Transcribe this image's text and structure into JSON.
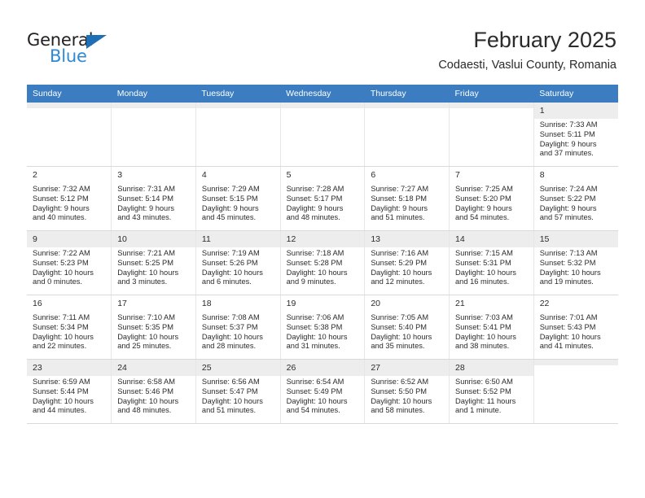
{
  "brand": {
    "name_part1": "General",
    "name_part2": "Blue",
    "accent_color": "#2e8ad4",
    "triangle_color": "#1f6fb5"
  },
  "header": {
    "title": "February 2025",
    "subtitle": "Codaesti, Vaslui County, Romania"
  },
  "calendar": {
    "header_color": "#3b7dc0",
    "weekdays": [
      "Sunday",
      "Monday",
      "Tuesday",
      "Wednesday",
      "Thursday",
      "Friday",
      "Saturday"
    ],
    "weeks": [
      [
        {
          "day": "",
          "sunrise": "",
          "sunset": "",
          "daylight1": "",
          "daylight2": ""
        },
        {
          "day": "",
          "sunrise": "",
          "sunset": "",
          "daylight1": "",
          "daylight2": ""
        },
        {
          "day": "",
          "sunrise": "",
          "sunset": "",
          "daylight1": "",
          "daylight2": ""
        },
        {
          "day": "",
          "sunrise": "",
          "sunset": "",
          "daylight1": "",
          "daylight2": ""
        },
        {
          "day": "",
          "sunrise": "",
          "sunset": "",
          "daylight1": "",
          "daylight2": ""
        },
        {
          "day": "",
          "sunrise": "",
          "sunset": "",
          "daylight1": "",
          "daylight2": ""
        },
        {
          "day": "1",
          "sunrise": "Sunrise: 7:33 AM",
          "sunset": "Sunset: 5:11 PM",
          "daylight1": "Daylight: 9 hours",
          "daylight2": "and 37 minutes."
        }
      ],
      [
        {
          "day": "2",
          "sunrise": "Sunrise: 7:32 AM",
          "sunset": "Sunset: 5:12 PM",
          "daylight1": "Daylight: 9 hours",
          "daylight2": "and 40 minutes."
        },
        {
          "day": "3",
          "sunrise": "Sunrise: 7:31 AM",
          "sunset": "Sunset: 5:14 PM",
          "daylight1": "Daylight: 9 hours",
          "daylight2": "and 43 minutes."
        },
        {
          "day": "4",
          "sunrise": "Sunrise: 7:29 AM",
          "sunset": "Sunset: 5:15 PM",
          "daylight1": "Daylight: 9 hours",
          "daylight2": "and 45 minutes."
        },
        {
          "day": "5",
          "sunrise": "Sunrise: 7:28 AM",
          "sunset": "Sunset: 5:17 PM",
          "daylight1": "Daylight: 9 hours",
          "daylight2": "and 48 minutes."
        },
        {
          "day": "6",
          "sunrise": "Sunrise: 7:27 AM",
          "sunset": "Sunset: 5:18 PM",
          "daylight1": "Daylight: 9 hours",
          "daylight2": "and 51 minutes."
        },
        {
          "day": "7",
          "sunrise": "Sunrise: 7:25 AM",
          "sunset": "Sunset: 5:20 PM",
          "daylight1": "Daylight: 9 hours",
          "daylight2": "and 54 minutes."
        },
        {
          "day": "8",
          "sunrise": "Sunrise: 7:24 AM",
          "sunset": "Sunset: 5:22 PM",
          "daylight1": "Daylight: 9 hours",
          "daylight2": "and 57 minutes."
        }
      ],
      [
        {
          "day": "9",
          "sunrise": "Sunrise: 7:22 AM",
          "sunset": "Sunset: 5:23 PM",
          "daylight1": "Daylight: 10 hours",
          "daylight2": "and 0 minutes."
        },
        {
          "day": "10",
          "sunrise": "Sunrise: 7:21 AM",
          "sunset": "Sunset: 5:25 PM",
          "daylight1": "Daylight: 10 hours",
          "daylight2": "and 3 minutes."
        },
        {
          "day": "11",
          "sunrise": "Sunrise: 7:19 AM",
          "sunset": "Sunset: 5:26 PM",
          "daylight1": "Daylight: 10 hours",
          "daylight2": "and 6 minutes."
        },
        {
          "day": "12",
          "sunrise": "Sunrise: 7:18 AM",
          "sunset": "Sunset: 5:28 PM",
          "daylight1": "Daylight: 10 hours",
          "daylight2": "and 9 minutes."
        },
        {
          "day": "13",
          "sunrise": "Sunrise: 7:16 AM",
          "sunset": "Sunset: 5:29 PM",
          "daylight1": "Daylight: 10 hours",
          "daylight2": "and 12 minutes."
        },
        {
          "day": "14",
          "sunrise": "Sunrise: 7:15 AM",
          "sunset": "Sunset: 5:31 PM",
          "daylight1": "Daylight: 10 hours",
          "daylight2": "and 16 minutes."
        },
        {
          "day": "15",
          "sunrise": "Sunrise: 7:13 AM",
          "sunset": "Sunset: 5:32 PM",
          "daylight1": "Daylight: 10 hours",
          "daylight2": "and 19 minutes."
        }
      ],
      [
        {
          "day": "16",
          "sunrise": "Sunrise: 7:11 AM",
          "sunset": "Sunset: 5:34 PM",
          "daylight1": "Daylight: 10 hours",
          "daylight2": "and 22 minutes."
        },
        {
          "day": "17",
          "sunrise": "Sunrise: 7:10 AM",
          "sunset": "Sunset: 5:35 PM",
          "daylight1": "Daylight: 10 hours",
          "daylight2": "and 25 minutes."
        },
        {
          "day": "18",
          "sunrise": "Sunrise: 7:08 AM",
          "sunset": "Sunset: 5:37 PM",
          "daylight1": "Daylight: 10 hours",
          "daylight2": "and 28 minutes."
        },
        {
          "day": "19",
          "sunrise": "Sunrise: 7:06 AM",
          "sunset": "Sunset: 5:38 PM",
          "daylight1": "Daylight: 10 hours",
          "daylight2": "and 31 minutes."
        },
        {
          "day": "20",
          "sunrise": "Sunrise: 7:05 AM",
          "sunset": "Sunset: 5:40 PM",
          "daylight1": "Daylight: 10 hours",
          "daylight2": "and 35 minutes."
        },
        {
          "day": "21",
          "sunrise": "Sunrise: 7:03 AM",
          "sunset": "Sunset: 5:41 PM",
          "daylight1": "Daylight: 10 hours",
          "daylight2": "and 38 minutes."
        },
        {
          "day": "22",
          "sunrise": "Sunrise: 7:01 AM",
          "sunset": "Sunset: 5:43 PM",
          "daylight1": "Daylight: 10 hours",
          "daylight2": "and 41 minutes."
        }
      ],
      [
        {
          "day": "23",
          "sunrise": "Sunrise: 6:59 AM",
          "sunset": "Sunset: 5:44 PM",
          "daylight1": "Daylight: 10 hours",
          "daylight2": "and 44 minutes."
        },
        {
          "day": "24",
          "sunrise": "Sunrise: 6:58 AM",
          "sunset": "Sunset: 5:46 PM",
          "daylight1": "Daylight: 10 hours",
          "daylight2": "and 48 minutes."
        },
        {
          "day": "25",
          "sunrise": "Sunrise: 6:56 AM",
          "sunset": "Sunset: 5:47 PM",
          "daylight1": "Daylight: 10 hours",
          "daylight2": "and 51 minutes."
        },
        {
          "day": "26",
          "sunrise": "Sunrise: 6:54 AM",
          "sunset": "Sunset: 5:49 PM",
          "daylight1": "Daylight: 10 hours",
          "daylight2": "and 54 minutes."
        },
        {
          "day": "27",
          "sunrise": "Sunrise: 6:52 AM",
          "sunset": "Sunset: 5:50 PM",
          "daylight1": "Daylight: 10 hours",
          "daylight2": "and 58 minutes."
        },
        {
          "day": "28",
          "sunrise": "Sunrise: 6:50 AM",
          "sunset": "Sunset: 5:52 PM",
          "daylight1": "Daylight: 11 hours",
          "daylight2": "and 1 minute."
        },
        {
          "day": "",
          "sunrise": "",
          "sunset": "",
          "daylight1": "",
          "daylight2": ""
        }
      ]
    ]
  }
}
